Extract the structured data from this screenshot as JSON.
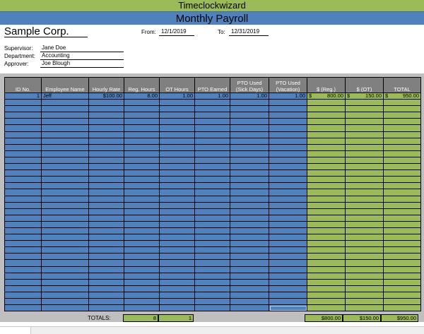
{
  "header": {
    "brand": "Timeclockwizard",
    "title": "Monthly Payroll"
  },
  "company": "Sample Corp.",
  "dates": {
    "from_label": "From:",
    "from_value": "12/1/2019",
    "to_label": "To:",
    "to_value": "12/31/2019"
  },
  "info": {
    "supervisor_label": "Supervisor:",
    "supervisor_value": "Jane Doe",
    "department_label": "Department:",
    "department_value": "Accounting",
    "approver_label": "Approver:",
    "approver_value": "Joe Blough"
  },
  "columns": [
    {
      "label": "ID No."
    },
    {
      "label": "Employee Name"
    },
    {
      "label": "Hourly Rate"
    },
    {
      "label": "Reg. Hours"
    },
    {
      "label": "OT Hours"
    },
    {
      "label": "PTO Earned"
    },
    {
      "label": "PTO Used (Sick Days)"
    },
    {
      "label": "PTO Used (Vacation)"
    },
    {
      "label": "$ (Reg.)"
    },
    {
      "label": "$ (OT)"
    },
    {
      "label": "TOTAL"
    }
  ],
  "rows": [
    {
      "id": "1",
      "name": "Jeff",
      "rate": "$100.00",
      "reg_hours": "8.00",
      "ot_hours": "1.00",
      "pto_earned": "1.00",
      "pto_sick": "1.00",
      "pto_vacation": "1.00",
      "reg_pay": "800.00",
      "ot_pay": "150.00",
      "total": "950.00"
    }
  ],
  "currency_symbol": "$",
  "totals": {
    "label": "TOTALS:",
    "reg_hours": "8",
    "ot_hours": "1",
    "reg_pay": "$800.00",
    "ot_pay": "$150.00",
    "total": "$950.00"
  },
  "colors": {
    "green": "#9bbb59",
    "blue": "#4f81bd",
    "header_gray": "#808080"
  }
}
